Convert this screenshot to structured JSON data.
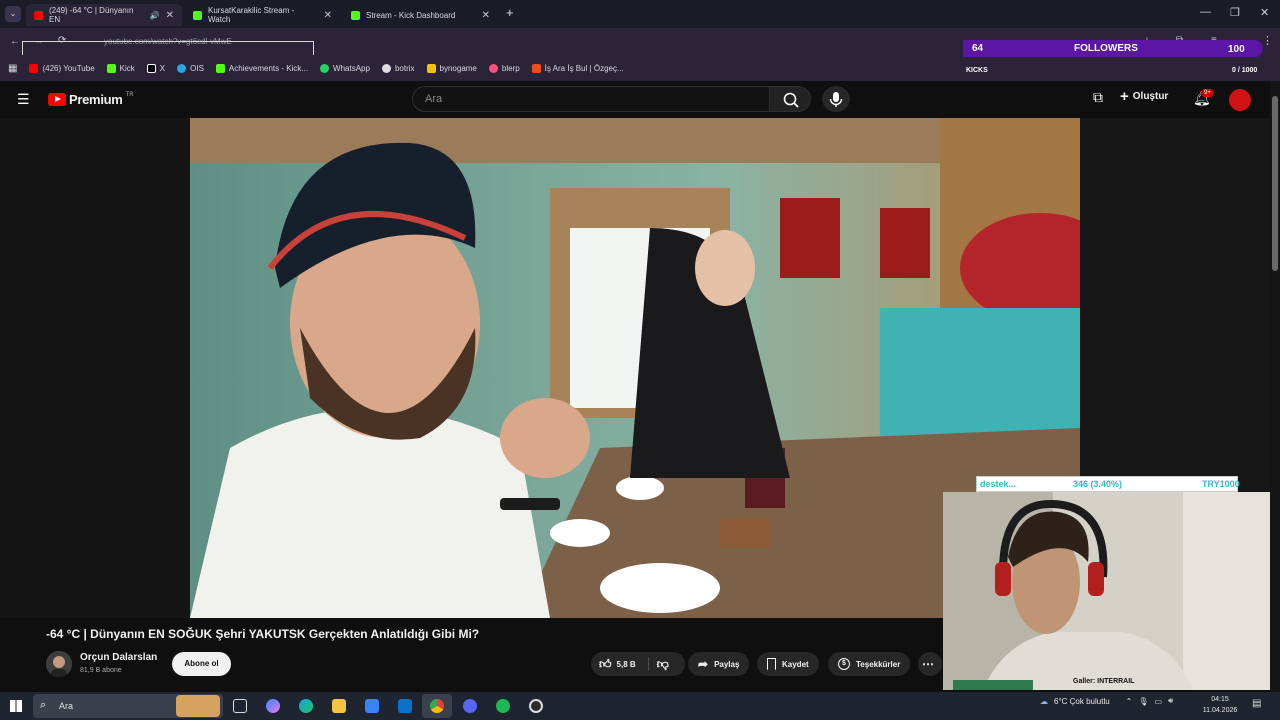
{
  "browser": {
    "tabs": [
      {
        "label": "(249) -64 °C | Dünyanın EN",
        "favicon_color": "#ff0000"
      },
      {
        "label": "KursatKarakilic Stream - Watch",
        "favicon_color": "#53fc18"
      },
      {
        "label": "Stream - Kick Dashboard",
        "favicon_color": "#53fc18"
      }
    ],
    "new_tab": "+",
    "url": "youtube.com/watch?v=gt6cdl-vMwE",
    "bookmarks": [
      {
        "label": "(426) YouTube",
        "color": "#ff0000"
      },
      {
        "label": "Kick",
        "color": "#53fc18"
      },
      {
        "label": "X",
        "color": "#ffffff"
      },
      {
        "label": "OIS",
        "color": "#27a7e0"
      },
      {
        "label": "Achievements - Kick...",
        "color": "#53fc18"
      },
      {
        "label": "WhatsApp",
        "color": "#25d366"
      },
      {
        "label": "botrix",
        "color": "#dddddd"
      },
      {
        "label": "bynogame",
        "color": "#f4c20d"
      },
      {
        "label": "blerp",
        "color": "#ff4f7b"
      },
      {
        "label": "İş Ara İş Bul | Özgeç...",
        "color": "#e94e1b"
      }
    ]
  },
  "kick_overlay": {
    "followers_count": "64",
    "followers_label": "FOLLOWERS",
    "followers_goal": "100",
    "kicks_label": "KICKS",
    "kicks_progress": "0 / 1000"
  },
  "youtube": {
    "logo_text": "Premium",
    "logo_badge": "TR",
    "search_placeholder": "Ara",
    "create_label": "Oluştur",
    "notif_badge": "9+",
    "video_title": "-64 °C | Dünyanın EN SOĞUK Şehri YAKUTSK Gerçekten Anlatıldığı Gibi Mi?",
    "channel_name": "Orçun Dalarslan",
    "subscribers": "81,9 B abone",
    "subscribe_label": "Abone ol",
    "like_count": "5,8 B",
    "share_label": "Paylaş",
    "save_label": "Kaydet",
    "thanks_label": "Teşekkürler"
  },
  "donation_bar": {
    "label": "destek...",
    "progress": "346 (3.40%)",
    "goal": "TRY1000"
  },
  "webcam_caption": "Galler: INTERRAIL",
  "taskbar": {
    "search_label": "Ara",
    "weather": "6°C  Çok bulutlu",
    "time": "04:15",
    "date": "11.04.2026"
  }
}
